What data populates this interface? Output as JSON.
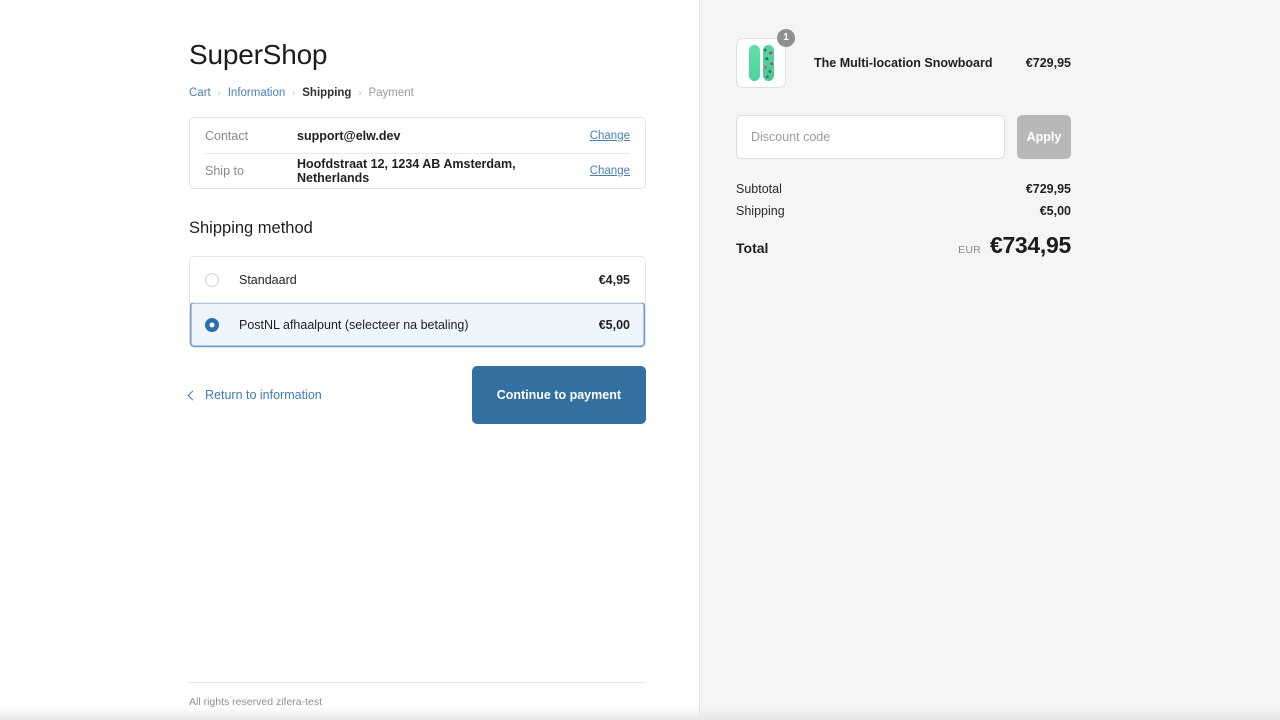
{
  "brand": {
    "name": "SuperShop"
  },
  "breadcrumb": {
    "items": [
      {
        "label": "Cart",
        "state": "link"
      },
      {
        "label": "Information",
        "state": "link"
      },
      {
        "label": "Shipping",
        "state": "current"
      },
      {
        "label": "Payment",
        "state": "muted"
      }
    ],
    "separator": "›"
  },
  "review": {
    "rows": [
      {
        "label": "Contact",
        "value": "support@elw.dev",
        "action": "Change"
      },
      {
        "label": "Ship to",
        "value": "Hoofdstraat 12, 1234 AB Amsterdam, Netherlands",
        "action": "Change"
      }
    ]
  },
  "shipping": {
    "section_title": "Shipping method",
    "options": [
      {
        "name": "Standaard",
        "price": "€4,95",
        "selected": false
      },
      {
        "name": "PostNL afhaalpunt (selecteer na betaling)",
        "price": "€5,00",
        "selected": true
      }
    ]
  },
  "actions": {
    "return_label": "Return to information",
    "continue_label": "Continue to payment",
    "back_icon": "chevron-left-icon"
  },
  "footer": {
    "text": "All rights reserved zifera-test"
  },
  "summary": {
    "item": {
      "name": "The Multi-location Snowboard",
      "price": "€729,95",
      "quantity": "1",
      "thumbnail_icon": "snowboard-pair-thumbnail"
    },
    "discount": {
      "placeholder": "Discount code",
      "value": "",
      "apply_label": "Apply",
      "apply_enabled": false
    },
    "lines": [
      {
        "label": "Subtotal",
        "value": "€729,95"
      },
      {
        "label": "Shipping",
        "value": "€5,00"
      }
    ],
    "total": {
      "label": "Total",
      "currency": "EUR",
      "amount": "€734,95"
    }
  },
  "colors": {
    "accent_blue": "#33709f",
    "link_blue": "#4a7fb5",
    "selected_row_bg": "#eef5fc",
    "selected_row_border": "#6f9ccc",
    "summary_bg": "#f5f5f5",
    "apply_disabled": "#b8b8b8",
    "badge_grey": "#8f8f8f"
  }
}
